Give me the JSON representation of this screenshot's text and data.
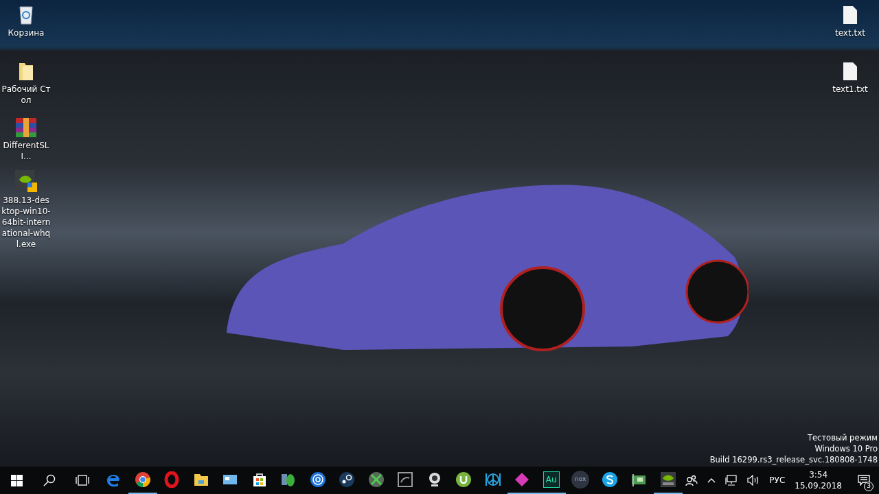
{
  "desktop": {
    "left_icons": [
      {
        "kind": "recycle-bin",
        "label": "Корзина"
      },
      {
        "kind": "folder",
        "label": "Рабочий Стол"
      },
      {
        "kind": "archive",
        "label": "DifferentSLI..."
      },
      {
        "kind": "installer",
        "label": "388.13-desktop-win10-64bit-international-whql.exe"
      }
    ],
    "right_icons": [
      {
        "kind": "text-file",
        "label": "text.txt"
      },
      {
        "kind": "text-file",
        "label": "text1.txt"
      }
    ],
    "watermark_lines": [
      "Тестовый режим",
      "Windows 10 Pro",
      "Build 16299.rs3_release_svc.180808-1748"
    ]
  },
  "taskbar": {
    "apps": [
      {
        "kind": "edge",
        "running": false
      },
      {
        "kind": "chrome",
        "running": true
      },
      {
        "kind": "opera",
        "running": false
      },
      {
        "kind": "explorer",
        "running": false
      },
      {
        "kind": "control-panel",
        "running": false
      },
      {
        "kind": "store",
        "running": false
      },
      {
        "kind": "mouse",
        "running": false
      },
      {
        "kind": "swirl",
        "running": false
      },
      {
        "kind": "steam",
        "running": false
      },
      {
        "kind": "xbox",
        "running": false
      },
      {
        "kind": "geforce",
        "running": false
      },
      {
        "kind": "webcam",
        "running": false
      },
      {
        "kind": "utorrent",
        "running": false
      },
      {
        "kind": "peace",
        "running": false
      },
      {
        "kind": "diamond",
        "running": true
      },
      {
        "kind": "audition",
        "running": true,
        "label": "Au"
      },
      {
        "kind": "nox",
        "running": false,
        "label": "nox"
      },
      {
        "kind": "skype",
        "running": false
      },
      {
        "kind": "card",
        "running": false
      },
      {
        "kind": "nvidia",
        "running": true
      }
    ],
    "tray": {
      "language": "РУС",
      "time": "3:54",
      "date": "15.09.2018",
      "notifications": "3"
    }
  }
}
